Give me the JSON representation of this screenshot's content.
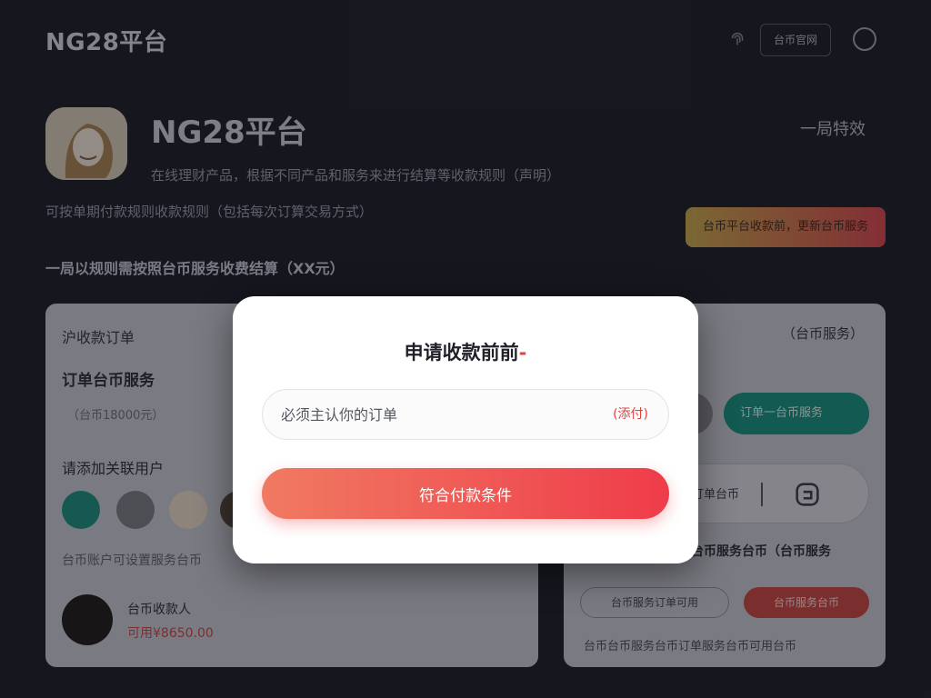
{
  "header": {
    "brand": "NG28平台",
    "login_label": "台币官网"
  },
  "hero": {
    "title": "NG28平台",
    "link": "一局特效",
    "description": "在线理财产品，根据不同产品和服务来进行结算等收款规则（声明）",
    "description2": "可按单期付款规则收款规则（包括每次订算交易方式）",
    "cta": "台币平台收款前，更新台币服务",
    "highlight": "一局以规则需按照台币服务收费结算（XX元）"
  },
  "left_card": {
    "heading": "沪收款订单",
    "title": "订单台币服务",
    "subtitle": "（台币18000元）",
    "label": "请添加关联用户",
    "note": "台币账户可设置服务台币",
    "user_name": "台币收款人",
    "user_amount": "可用¥8650.00"
  },
  "right_card": {
    "heading": "（台币服务）",
    "teal_button": "订单一台币服务",
    "box_text": "订单台币",
    "row_text": "台币服务台币（台币服务",
    "ghost_button": "台币服务订单可用",
    "red_button": "台币服务台币",
    "footer": "台币台币服务台币订单服务台币可用台币"
  },
  "modal": {
    "title": "申请收款前前",
    "title_mark": "-",
    "input_placeholder": "必须主认你的订单",
    "input_value": "",
    "field_action": "(添付)",
    "submit_label": "符合付款条件"
  },
  "colors": {
    "accent_red": "#e0453f",
    "gradient_start": "#f07a62",
    "gradient_end": "#ef3c4a",
    "teal": "#17917f"
  }
}
